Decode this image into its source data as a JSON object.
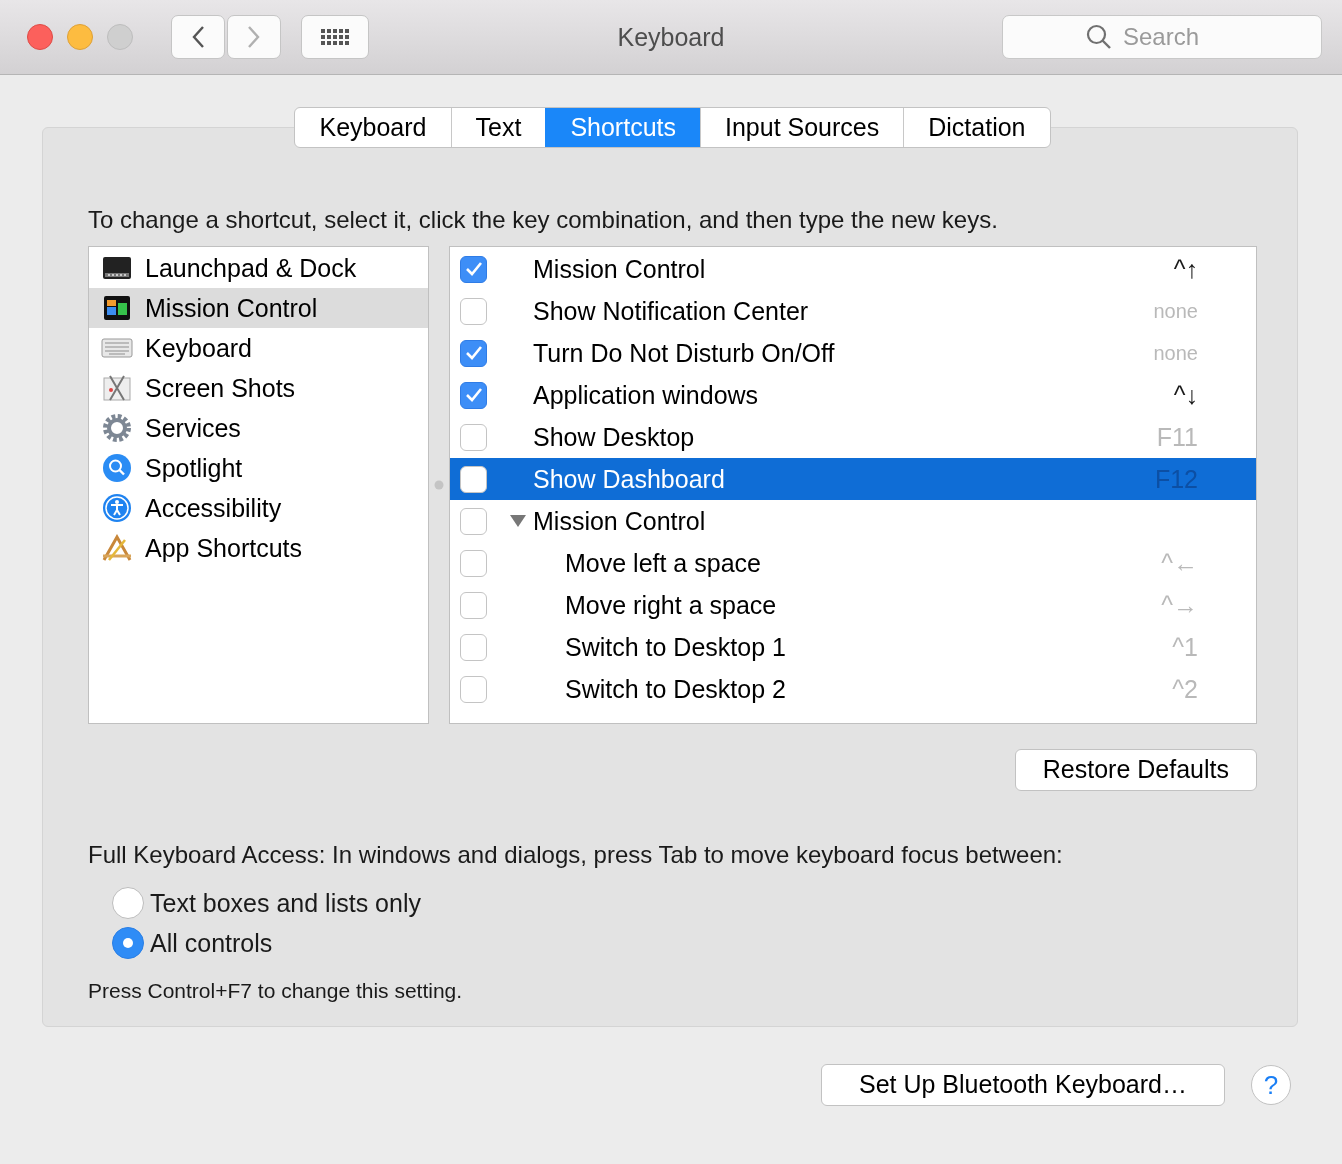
{
  "window": {
    "title": "Keyboard",
    "search": {
      "placeholder": "Search"
    }
  },
  "tabs": [
    {
      "label": "Keyboard",
      "selected": false
    },
    {
      "label": "Text",
      "selected": false
    },
    {
      "label": "Shortcuts",
      "selected": true
    },
    {
      "label": "Input Sources",
      "selected": false
    },
    {
      "label": "Dictation",
      "selected": false
    }
  ],
  "instructions": "To change a shortcut, select it, click the key combination, and then type the new keys.",
  "categories": [
    {
      "label": "Launchpad & Dock",
      "selected": false
    },
    {
      "label": "Mission Control",
      "selected": true
    },
    {
      "label": "Keyboard",
      "selected": false
    },
    {
      "label": "Screen Shots",
      "selected": false
    },
    {
      "label": "Services",
      "selected": false
    },
    {
      "label": "Spotlight",
      "selected": false
    },
    {
      "label": "Accessibility",
      "selected": false
    },
    {
      "label": "App Shortcuts",
      "selected": false
    }
  ],
  "shortcuts": [
    {
      "label": "Mission Control",
      "checked": true,
      "selected": false,
      "shortcut": "^↑",
      "dimmed": false
    },
    {
      "label": "Show Notification Center",
      "checked": false,
      "selected": false,
      "shortcut": "none",
      "dimmed": true
    },
    {
      "label": "Turn Do Not Disturb On/Off",
      "checked": true,
      "selected": false,
      "shortcut": "none",
      "dimmed": true
    },
    {
      "label": "Application windows",
      "checked": true,
      "selected": false,
      "shortcut": "^↓",
      "dimmed": false
    },
    {
      "label": "Show Desktop",
      "checked": false,
      "selected": false,
      "shortcut": "F11",
      "dimmed": true
    },
    {
      "label": "Show Dashboard",
      "checked": false,
      "selected": true,
      "shortcut": "F12",
      "dimmed": true
    },
    {
      "label": "Mission Control",
      "checked": false,
      "selected": false,
      "expanded": true,
      "children": [
        {
          "label": "Move left a space",
          "checked": false,
          "selected": false,
          "shortcut": "^←",
          "dimmed": true
        },
        {
          "label": "Move right a space",
          "checked": false,
          "selected": false,
          "shortcut": "^→",
          "dimmed": true
        },
        {
          "label": "Switch to Desktop 1",
          "checked": false,
          "selected": false,
          "shortcut": "^1",
          "dimmed": true
        },
        {
          "label": "Switch to Desktop 2",
          "checked": false,
          "selected": false,
          "shortcut": "^2",
          "dimmed": true
        }
      ]
    }
  ],
  "restore_button": "Restore Defaults",
  "keyboard_access": {
    "label": "Full Keyboard Access: In windows and dialogs, press Tab to move keyboard focus between:",
    "options": [
      {
        "label": "Text boxes and lists only",
        "selected": false
      },
      {
        "label": "All controls",
        "selected": true
      }
    ],
    "hint": "Press Control+F7 to change this setting."
  },
  "footer": {
    "bluetooth_button": "Set Up Bluetooth Keyboard…",
    "help_button": "?"
  }
}
